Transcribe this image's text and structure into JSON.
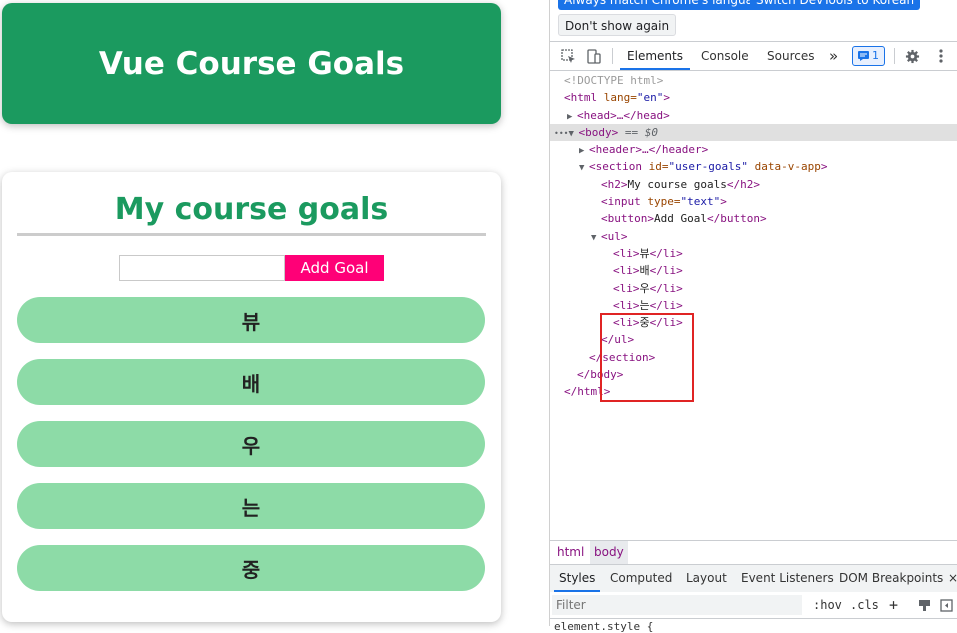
{
  "app": {
    "header_title": "Vue Course Goals",
    "section_title": "My course goals",
    "input_value": "",
    "add_goal_label": "Add Goal",
    "goals": [
      "뷰",
      "배",
      "우",
      "는",
      "중"
    ],
    "colors": {
      "header_bg": "#1b9a5f",
      "goal_bg": "#8ddba7",
      "button_bg": "#ff0077"
    }
  },
  "devtools": {
    "infobar": {
      "match_language": "Always match Chrome's language",
      "switch_language": "Switch DevTools to Korean",
      "dont_show": "Don't show again"
    },
    "toolbar": {
      "tabs": [
        "Elements",
        "Console",
        "Sources"
      ],
      "more": "»",
      "issues_count": "1"
    },
    "dom": {
      "doctype": "<!DOCTYPE html>",
      "html_open": "<html",
      "html_attr": " lang=",
      "html_val": "\"en\"",
      "head": "<head>…</head>",
      "body_open": "<body>",
      "body_eq": " == $0",
      "header": "<header>…</header>",
      "section_open": "<section",
      "section_id_attr": " id=",
      "section_id_val": "\"user-goals\"",
      "section_app_attr": " data-v-app",
      "section_close_bracket": ">",
      "h2_open": "<h2>",
      "h2_text": "My course goals",
      "h2_close": "</h2>",
      "input_open": "<input",
      "input_attr": " type=",
      "input_val": "\"text\"",
      "input_close": ">",
      "button_open": "<button>",
      "button_text": "Add Goal",
      "button_close": "</button>",
      "ul_open": "<ul>",
      "li_open": "<li>",
      "li_close": "</li>",
      "ul_close": "</ul>",
      "section_close": "</section>",
      "body_close": "</body>",
      "html_close": "</html>",
      "ellipsis": "•••"
    },
    "breadcrumbs": [
      "html",
      "body"
    ],
    "styles_tabs": [
      "Styles",
      "Computed",
      "Layout",
      "Event Listeners",
      "DOM Breakpoints"
    ],
    "styles_more": "×",
    "filter_placeholder": "Filter",
    "hov": ":hov",
    "cls": ".cls",
    "plus": "+",
    "element_style": "element.style {"
  }
}
